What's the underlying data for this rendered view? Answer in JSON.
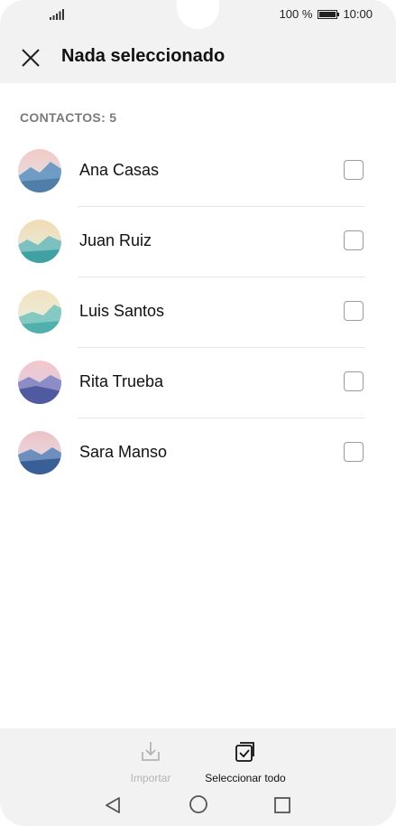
{
  "status": {
    "battery": "100 %",
    "time": "10:00"
  },
  "appbar": {
    "title": "Nada seleccionado"
  },
  "list": {
    "section_header": "CONTACTOS: 5",
    "contacts": [
      {
        "name": "Ana Casas",
        "checked": false
      },
      {
        "name": "Juan Ruiz",
        "checked": false
      },
      {
        "name": "Luis Santos",
        "checked": false
      },
      {
        "name": "Rita Trueba",
        "checked": false
      },
      {
        "name": "Sara Manso",
        "checked": false
      }
    ]
  },
  "bottom": {
    "import_label": "Importar",
    "select_all_label": "Seleccionar todo"
  },
  "icons": {
    "close": "close-icon",
    "import": "download-icon",
    "select_all": "select-all-icon",
    "back": "back-icon",
    "home": "home-icon",
    "recents": "recents-icon"
  },
  "colors": {
    "background": "#ffffff",
    "chrome": "#f2f2f2",
    "disabled_text": "#b5b5b5"
  }
}
